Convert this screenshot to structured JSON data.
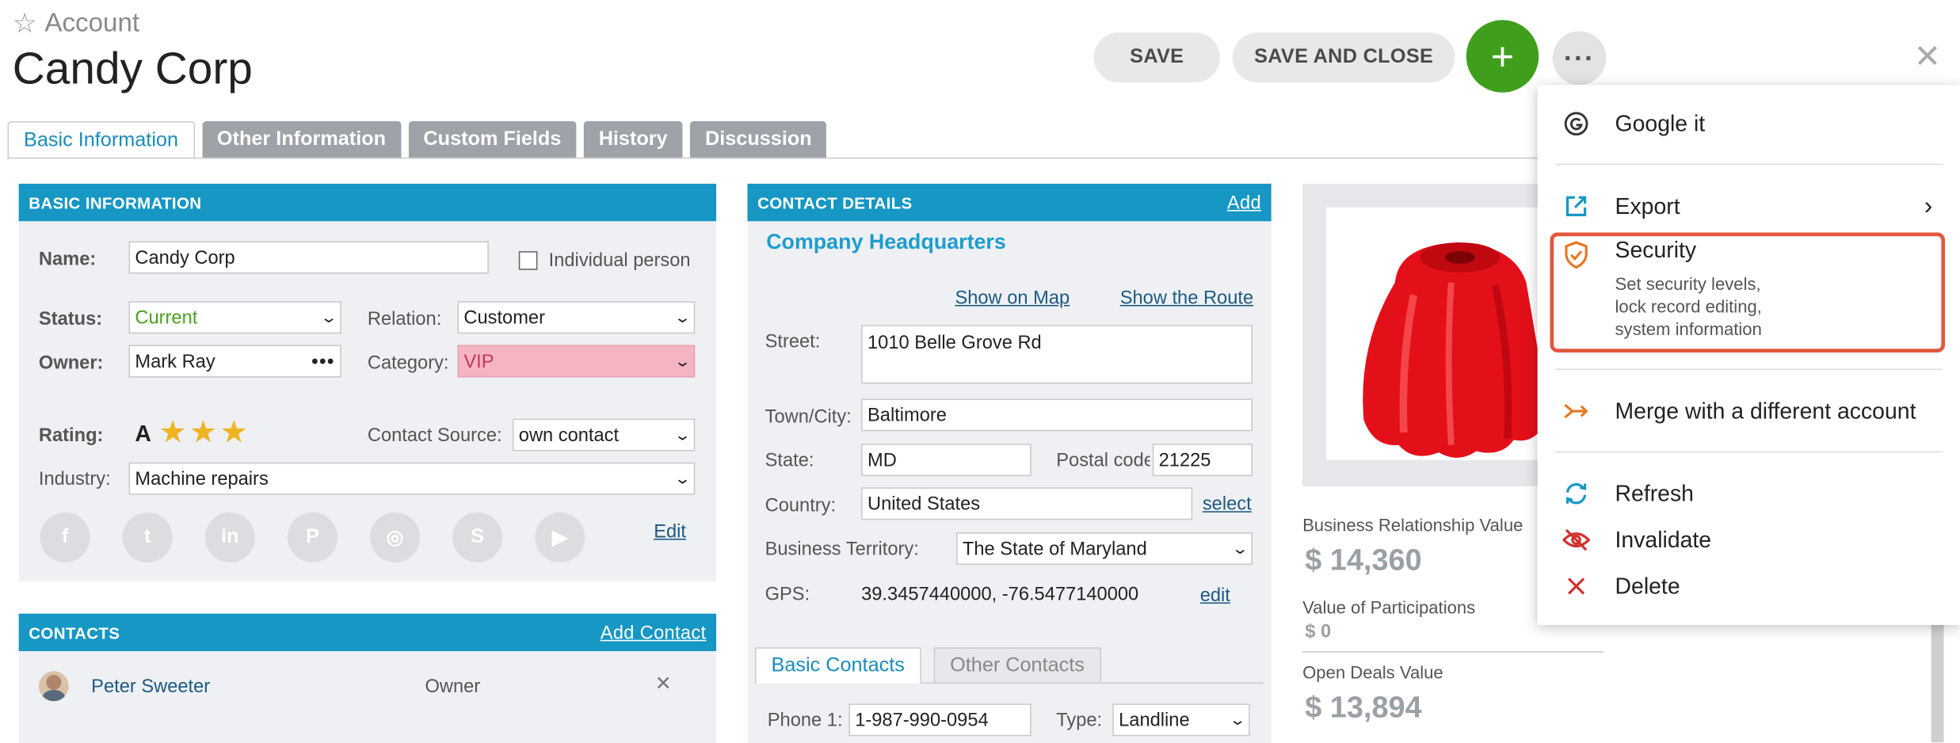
{
  "header": {
    "breadcrumb": "Account",
    "title": "Candy Corp",
    "save": "SAVE",
    "save_close": "SAVE AND CLOSE",
    "plus": "+",
    "more": "···",
    "close": "✕"
  },
  "tabs": [
    "Basic Information",
    "Other Information",
    "Custom Fields",
    "History",
    "Discussion"
  ],
  "basic": {
    "heading": "BASIC INFORMATION",
    "name_label": "Name:",
    "name": "Candy Corp",
    "individual": "Individual person",
    "status_label": "Status:",
    "status": "Current",
    "relation_label": "Relation:",
    "relation": "Customer",
    "owner_label": "Owner:",
    "owner": "Mark Ray",
    "category_label": "Category:",
    "category": "VIP",
    "rating_label": "Rating:",
    "rating_grade": "A",
    "rating_stars": 3,
    "source_label": "Contact Source:",
    "source": "own contact",
    "industry_label": "Industry:",
    "industry": "Machine repairs",
    "edit": "Edit",
    "socials": [
      "facebook-icon",
      "twitter-icon",
      "linkedin-icon",
      "pinterest-icon",
      "instagram-icon",
      "skype-icon",
      "youtube-icon"
    ]
  },
  "contacts": {
    "heading": "CONTACTS",
    "add": "Add Contact",
    "rows": [
      {
        "name": "Peter Sweeter",
        "role": "Owner",
        "remove": "✕"
      }
    ]
  },
  "details": {
    "heading": "CONTACT DETAILS",
    "add": "Add",
    "hq": "Company Headquarters",
    "show_map": "Show on Map",
    "show_route": "Show the Route",
    "street_label": "Street:",
    "street": "1010 Belle Grove Rd",
    "town_label": "Town/City:",
    "town": "Baltimore",
    "state_label": "State:",
    "state": "MD",
    "postal_label": "Postal code:",
    "postal": "21225",
    "country_label": "Country:",
    "country": "United States",
    "select": "select",
    "territory_label": "Business Territory:",
    "territory": "The State of Maryland",
    "gps_label": "GPS:",
    "gps": "39.3457440000, -76.5477140000",
    "gps_edit": "edit",
    "subtabs": [
      "Basic Contacts",
      "Other Contacts"
    ],
    "phone_label": "Phone 1:",
    "phone": "1-987-990-0954",
    "type_label": "Type:",
    "type": "Landline"
  },
  "values": {
    "brv_label": "Business Relationship Value",
    "brv": "$ 14,360",
    "vop_label": "Value of Participations",
    "vop": "$ 0",
    "odv_label": "Open Deals Value",
    "odv": "$ 13,894"
  },
  "menu": {
    "google": "Google it",
    "export": "Export",
    "security": "Security",
    "security_desc1": "Set security levels,",
    "security_desc2": "lock record editing,",
    "security_desc3": "system information",
    "merge": "Merge with a different account",
    "refresh": "Refresh",
    "invalidate": "Invalidate",
    "delete": "Delete",
    "colors": {
      "highlight": "#e3583e",
      "accent": "#1697c4"
    }
  }
}
